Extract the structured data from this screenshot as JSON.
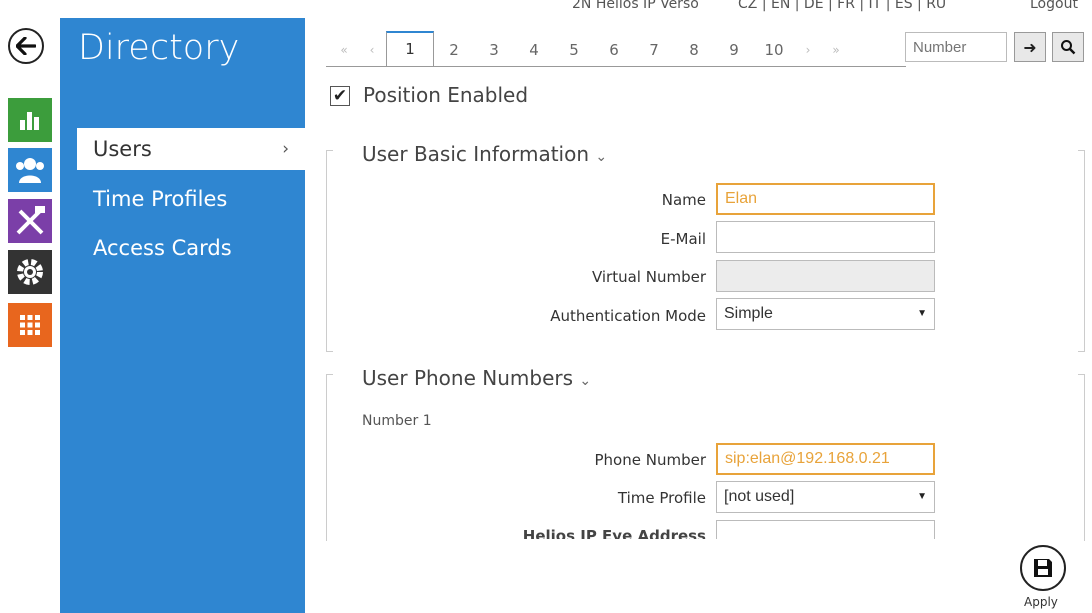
{
  "topbar": {
    "left_text": "2N Helios IP Verso",
    "langs": "CZ | EN | DE | FR | IT | ES | RU",
    "logout": "Logout"
  },
  "rail": {
    "back_icon": "arrow-left-icon",
    "icons": [
      {
        "name": "status-icon",
        "color": "#3c9d3c"
      },
      {
        "name": "directory-icon",
        "color": "#2f86d1"
      },
      {
        "name": "hardware-tools-icon",
        "color": "#7b3fa8"
      },
      {
        "name": "settings-gear-icon",
        "color": "#333333"
      },
      {
        "name": "grid-icon",
        "color": "#e8661e"
      }
    ]
  },
  "sidebar": {
    "title": "Directory",
    "items": [
      {
        "label": "Users",
        "active": true
      },
      {
        "label": "Time Profiles",
        "active": false
      },
      {
        "label": "Access Cards",
        "active": false
      }
    ],
    "chevron": "›"
  },
  "pager": {
    "first": "«",
    "prev": "‹",
    "pages": [
      "1",
      "2",
      "3",
      "4",
      "5",
      "6",
      "7",
      "8",
      "9",
      "10"
    ],
    "current": "1",
    "next": "›",
    "last": "»",
    "number_placeholder": "Number",
    "go_label": "➜",
    "search_icon": "search-icon"
  },
  "position_enabled": {
    "label": "Position Enabled",
    "checked": true
  },
  "basic_info": {
    "title": "User Basic Information",
    "toggle": "⌄",
    "fields": {
      "name_label": "Name",
      "name_value": "Elan",
      "email_label": "E-Mail",
      "email_value": "",
      "virtual_label": "Virtual Number",
      "virtual_value": "",
      "auth_label": "Authentication Mode",
      "auth_value": "Simple"
    }
  },
  "phone_numbers": {
    "title": "User Phone Numbers",
    "toggle": "⌄",
    "number_label": "Number 1",
    "phone_label": "Phone Number",
    "phone_value": "sip:elan@192.168.0.21",
    "time_profile_label": "Time Profile",
    "time_profile_value": "[not used]",
    "eye_label": "Helios IP Eye Address",
    "eye_value": ""
  },
  "apply": {
    "label": "Apply",
    "icon": "save-disk-icon"
  },
  "colors": {
    "accent": "#2f86d1",
    "focus": "#e8a33a"
  }
}
